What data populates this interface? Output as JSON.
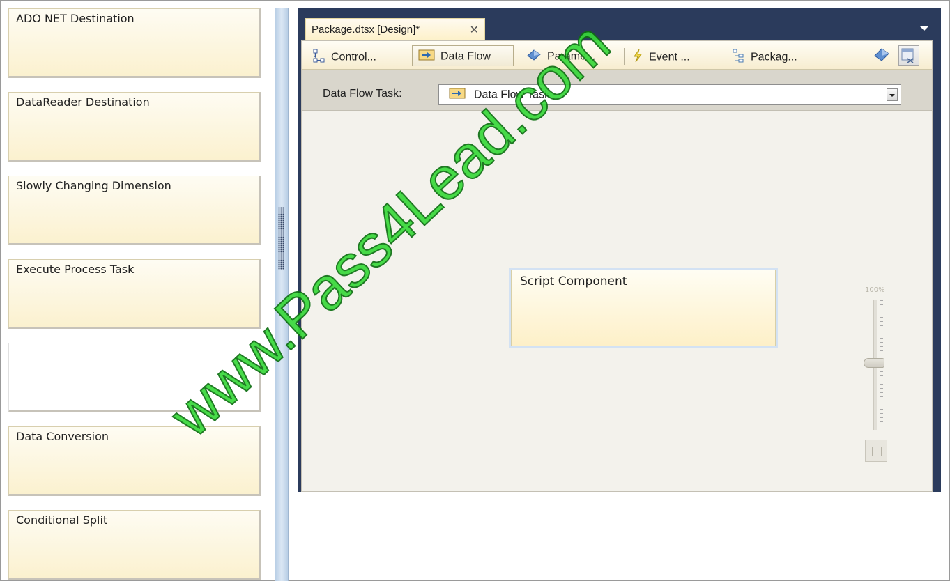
{
  "toolbox": {
    "items": [
      {
        "label": "ADO NET Destination"
      },
      {
        "label": "DataReader Destination"
      },
      {
        "label": "Slowly Changing Dimension"
      },
      {
        "label": "Execute Process Task"
      },
      {
        "label": ""
      },
      {
        "label": "Data Conversion"
      },
      {
        "label": "Conditional Split"
      }
    ]
  },
  "document_tab": {
    "title": "Package.dtsx [Design]*",
    "close": "✕"
  },
  "designer_tabs": [
    {
      "label": "Control...",
      "icon": "control-flow-icon"
    },
    {
      "label": "Data Flow",
      "icon": "data-flow-icon",
      "active": true
    },
    {
      "label": "Parame...",
      "icon": "parameters-icon"
    },
    {
      "label": "Event ...",
      "icon": "event-handlers-icon"
    },
    {
      "label": "Packag...",
      "icon": "package-explorer-icon"
    }
  ],
  "data_flow_task": {
    "label": "Data Flow Task:",
    "selected": "Data Flow Task"
  },
  "canvas": {
    "component_label": "Script Component",
    "zoom_label": "100%",
    "zoom_level": 0.5
  },
  "watermark": "www.Pass4Lead.com",
  "colors": {
    "accent_navy": "#2b3b5c",
    "component_fill": "#fdf0c8",
    "watermark_green": "#38d83a"
  }
}
